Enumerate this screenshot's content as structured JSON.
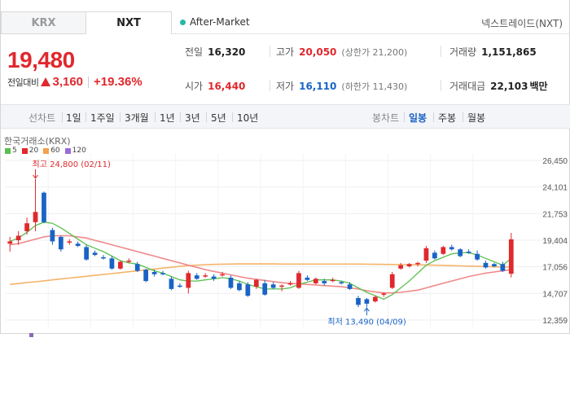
{
  "tabs": [
    {
      "label": "KRX",
      "active": false
    },
    {
      "label": "NXT",
      "active": true
    }
  ],
  "after_market_label": "After-Market",
  "provider_label": "넥스트레이드(NXT)",
  "price": {
    "current": "19,480",
    "change_label": "전일대비",
    "change_amount": "3,160",
    "change_percent": "+19.36%"
  },
  "stats": {
    "prev_close": {
      "label": "전일",
      "value": "16,320"
    },
    "open": {
      "label": "시가",
      "value": "16,440"
    },
    "high": {
      "label": "고가",
      "value": "20,050",
      "sub": "(상한가 21,200)"
    },
    "low": {
      "label": "저가",
      "value": "16,110",
      "sub": "(하한가 11,430)"
    },
    "volume": {
      "label": "거래량",
      "value": "1,151,865"
    },
    "amount": {
      "label": "거래대금",
      "value": "22,103",
      "unit": "백만"
    }
  },
  "toolbar": {
    "line_chart": "선차트",
    "periods": [
      "1일",
      "1주일",
      "3개월",
      "1년",
      "3년",
      "5년",
      "10년"
    ],
    "candle_chart": "봉차트",
    "candle_periods": [
      "일봉",
      "주봉",
      "월봉"
    ],
    "selected_candle_period": "일봉"
  },
  "colors": {
    "up": "#e0282d",
    "down": "#1a63c6",
    "ma5": "#5bbf4f",
    "ma20": "#f08a8a",
    "ma60": "#f5b46a",
    "ma120": "#9b6bd6"
  },
  "chart_data": {
    "type": "candlestick",
    "exchange_label": "한국거래소(KRX)",
    "legend": [
      "5",
      "20",
      "60",
      "120"
    ],
    "y_ticks": [
      "26,450",
      "24,101",
      "21,753",
      "19,404",
      "17,056",
      "14,707",
      "12,359"
    ],
    "ylim": [
      12359,
      26450
    ],
    "annotations": {
      "high": "최고 24,800 (02/11)",
      "low": "최저 13,490 (04/09)"
    },
    "candles": [
      {
        "o": 19100,
        "h": 19700,
        "l": 18400,
        "c": 19300
      },
      {
        "o": 19400,
        "h": 20200,
        "l": 19000,
        "c": 19800
      },
      {
        "o": 20200,
        "h": 21400,
        "l": 19900,
        "c": 20900
      },
      {
        "o": 21000,
        "h": 24800,
        "l": 20200,
        "c": 21900
      },
      {
        "o": 23600,
        "h": 23700,
        "l": 20900,
        "c": 21000
      },
      {
        "o": 20300,
        "h": 20500,
        "l": 19000,
        "c": 19300
      },
      {
        "o": 19700,
        "h": 19800,
        "l": 18400,
        "c": 18600
      },
      {
        "o": 19300,
        "h": 19500,
        "l": 19000,
        "c": 19300
      },
      {
        "o": 19100,
        "h": 19300,
        "l": 18800,
        "c": 18900
      },
      {
        "o": 18800,
        "h": 19000,
        "l": 17600,
        "c": 17700
      },
      {
        "o": 18300,
        "h": 18500,
        "l": 18000,
        "c": 18100
      },
      {
        "o": 17900,
        "h": 18100,
        "l": 17700,
        "c": 17800
      },
      {
        "o": 17800,
        "h": 18000,
        "l": 16800,
        "c": 16900
      },
      {
        "o": 16900,
        "h": 17600,
        "l": 16800,
        "c": 17500
      },
      {
        "o": 17600,
        "h": 17800,
        "l": 17400,
        "c": 17600
      },
      {
        "o": 17300,
        "h": 17500,
        "l": 16600,
        "c": 16700
      },
      {
        "o": 16800,
        "h": 16900,
        "l": 15700,
        "c": 15800
      },
      {
        "o": 16600,
        "h": 16800,
        "l": 16200,
        "c": 16400
      },
      {
        "o": 16500,
        "h": 16700,
        "l": 16300,
        "c": 16400
      },
      {
        "o": 16000,
        "h": 16200,
        "l": 15000,
        "c": 15100
      },
      {
        "o": 15400,
        "h": 15600,
        "l": 15200,
        "c": 15300
      },
      {
        "o": 15200,
        "h": 16700,
        "l": 14700,
        "c": 16500
      },
      {
        "o": 16300,
        "h": 16500,
        "l": 15900,
        "c": 16000
      },
      {
        "o": 16300,
        "h": 16500,
        "l": 16100,
        "c": 16300
      },
      {
        "o": 16200,
        "h": 16400,
        "l": 15800,
        "c": 16000
      },
      {
        "o": 16400,
        "h": 16600,
        "l": 16200,
        "c": 16400
      },
      {
        "o": 16100,
        "h": 16300,
        "l": 15100,
        "c": 15200
      },
      {
        "o": 15600,
        "h": 15800,
        "l": 14900,
        "c": 15000
      },
      {
        "o": 15500,
        "h": 15700,
        "l": 14400,
        "c": 14500
      },
      {
        "o": 15300,
        "h": 16000,
        "l": 15100,
        "c": 15900
      },
      {
        "o": 15600,
        "h": 15900,
        "l": 14500,
        "c": 14600
      },
      {
        "o": 15500,
        "h": 15700,
        "l": 15100,
        "c": 15200
      },
      {
        "o": 15300,
        "h": 15500,
        "l": 14900,
        "c": 15400
      },
      {
        "o": 15600,
        "h": 15800,
        "l": 15400,
        "c": 15600
      },
      {
        "o": 15200,
        "h": 16700,
        "l": 15100,
        "c": 16500
      },
      {
        "o": 16100,
        "h": 16300,
        "l": 15800,
        "c": 15900
      },
      {
        "o": 15600,
        "h": 16100,
        "l": 15500,
        "c": 16000
      },
      {
        "o": 15800,
        "h": 16000,
        "l": 15400,
        "c": 15600
      },
      {
        "o": 15900,
        "h": 16100,
        "l": 15700,
        "c": 15900
      },
      {
        "o": 15700,
        "h": 15800,
        "l": 15500,
        "c": 15600
      },
      {
        "o": 15500,
        "h": 15700,
        "l": 15000,
        "c": 15100
      },
      {
        "o": 14300,
        "h": 14500,
        "l": 13500,
        "c": 13700
      },
      {
        "o": 14200,
        "h": 14300,
        "l": 13490,
        "c": 13800
      },
      {
        "o": 14000,
        "h": 14500,
        "l": 13900,
        "c": 14400
      },
      {
        "o": 14600,
        "h": 14800,
        "l": 14400,
        "c": 14700
      },
      {
        "o": 15200,
        "h": 16600,
        "l": 15100,
        "c": 16400
      },
      {
        "o": 16900,
        "h": 17400,
        "l": 16800,
        "c": 17200
      },
      {
        "o": 17100,
        "h": 17400,
        "l": 17000,
        "c": 17300
      },
      {
        "o": 17300,
        "h": 17500,
        "l": 17100,
        "c": 17400
      },
      {
        "o": 17600,
        "h": 18900,
        "l": 17400,
        "c": 18700
      },
      {
        "o": 18300,
        "h": 18500,
        "l": 17700,
        "c": 17800
      },
      {
        "o": 18200,
        "h": 18900,
        "l": 18100,
        "c": 18800
      },
      {
        "o": 18800,
        "h": 19000,
        "l": 18500,
        "c": 18600
      },
      {
        "o": 18600,
        "h": 18700,
        "l": 17900,
        "c": 18000
      },
      {
        "o": 18400,
        "h": 18600,
        "l": 18200,
        "c": 18300
      },
      {
        "o": 18200,
        "h": 18500,
        "l": 17600,
        "c": 17700
      },
      {
        "o": 17400,
        "h": 17600,
        "l": 16900,
        "c": 17000
      },
      {
        "o": 17300,
        "h": 17400,
        "l": 17000,
        "c": 17100
      },
      {
        "o": 17300,
        "h": 17500,
        "l": 16600,
        "c": 16700
      },
      {
        "o": 16440,
        "h": 20050,
        "l": 16110,
        "c": 19480
      }
    ],
    "ma5": [
      19300,
      19600,
      20100,
      20700,
      21000,
      20900,
      20500,
      20000,
      19500,
      19000,
      18700,
      18400,
      18000,
      17600,
      17400,
      17300,
      17000,
      16700,
      16500,
      16200,
      15900,
      15800,
      15800,
      15900,
      16000,
      16100,
      16000,
      15800,
      15500,
      15300,
      15100,
      15100,
      15100,
      15200,
      15500,
      15700,
      15900,
      15900,
      15900,
      15800,
      15600,
      15200,
      14800,
      14500,
      14200,
      14600,
      15200,
      15800,
      16500,
      17200,
      17600,
      17900,
      18200,
      18300,
      18300,
      18100,
      17800,
      17500,
      17200,
      17800
    ],
    "ma20": [
      19000,
      19100,
      19300,
      19500,
      19700,
      19800,
      19800,
      19800,
      19700,
      19600,
      19400,
      19200,
      19000,
      18800,
      18600,
      18400,
      18200,
      18000,
      17800,
      17600,
      17400,
      17200,
      17000,
      16800,
      16650,
      16500,
      16350,
      16200,
      16050,
      15950,
      15850,
      15750,
      15650,
      15600,
      15550,
      15500,
      15450,
      15400,
      15350,
      15300,
      15200,
      15100,
      14950,
      14850,
      14750,
      14750,
      14800,
      14900,
      15000,
      15200,
      15400,
      15600,
      15800,
      16000,
      16200,
      16350,
      16500,
      16600,
      16700,
      16800
    ],
    "ma60": [
      15500,
      15580,
      15660,
      15740,
      15820,
      15900,
      15980,
      16060,
      16140,
      16220,
      16300,
      16380,
      16460,
      16540,
      16620,
      16700,
      16780,
      16860,
      16940,
      17020,
      17100,
      17160,
      17200,
      17240,
      17270,
      17290,
      17300,
      17310,
      17310,
      17310,
      17310,
      17310,
      17300,
      17300,
      17300,
      17300,
      17300,
      17300,
      17300,
      17300,
      17300,
      17300,
      17290,
      17280,
      17270,
      17260,
      17250,
      17240,
      17230,
      17220,
      17200,
      17180,
      17160,
      17140,
      17120,
      17100,
      17080,
      17060,
      17050,
      17040
    ]
  }
}
